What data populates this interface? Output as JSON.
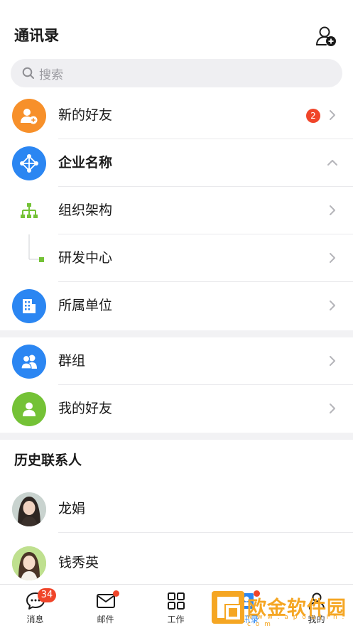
{
  "header": {
    "title": "通讯录",
    "add_contact_icon": "add-user-icon"
  },
  "search": {
    "placeholder": "搜索"
  },
  "rows": {
    "new_friends": {
      "label": "新的好友",
      "badge": "2",
      "color": "#f7902a"
    },
    "enterprise": {
      "label": "企业名称",
      "color": "#2b86f2"
    },
    "org_structure": {
      "label": "组织架构",
      "color": "#74c236"
    },
    "rnd_center": {
      "label": "研发中心",
      "color": "#74c236"
    },
    "unit": {
      "label": "所属单位",
      "color": "#2b86f2"
    },
    "groups": {
      "label": "群组",
      "color": "#2b86f2"
    },
    "my_friends": {
      "label": "我的好友",
      "color": "#74c236"
    }
  },
  "history": {
    "title": "历史联系人",
    "contacts": [
      {
        "name": "龙娟"
      },
      {
        "name": "钱秀英"
      }
    ]
  },
  "tabbar": {
    "tabs": [
      {
        "label": "消息",
        "badge": "34"
      },
      {
        "label": "邮件"
      },
      {
        "label": "工作"
      },
      {
        "label": "通讯录"
      },
      {
        "label": "我的"
      }
    ],
    "active_color": "#2b86f2"
  },
  "watermark": {
    "text": "欧金软件园",
    "url": "w w w . a p o u j i n . c o m"
  }
}
